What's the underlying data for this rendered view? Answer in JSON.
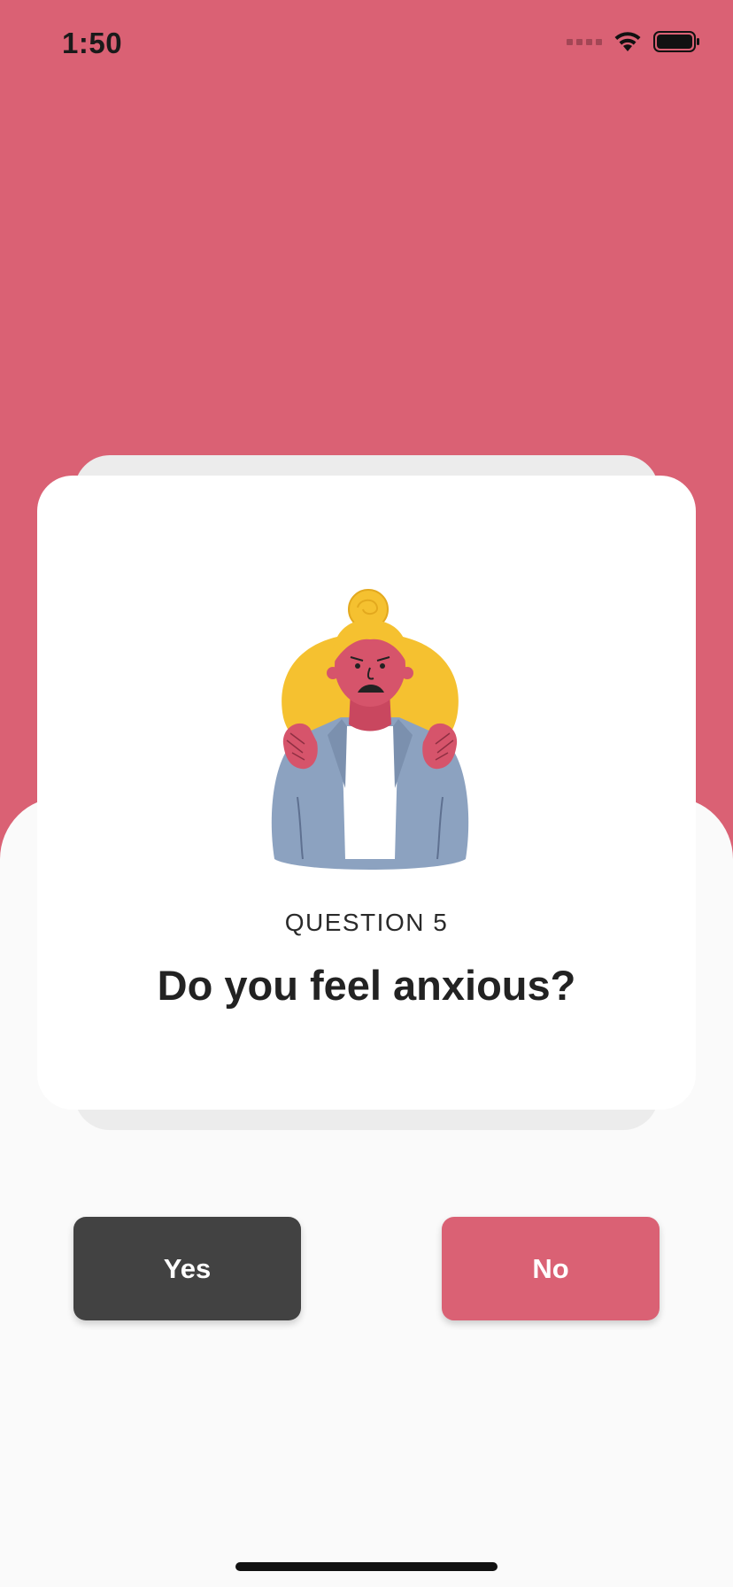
{
  "status_bar": {
    "time": "1:50"
  },
  "card": {
    "question_number": "QUESTION 5",
    "question_text": "Do you feel anxious?"
  },
  "actions": {
    "yes_label": "Yes",
    "no_label": "No"
  },
  "colors": {
    "primary": "#DA6174",
    "dark_button": "#424242",
    "background": "#FAFAFA"
  },
  "icons": [
    "wifi-icon",
    "battery-icon",
    "signal-icon",
    "anxious-person-illustration"
  ]
}
